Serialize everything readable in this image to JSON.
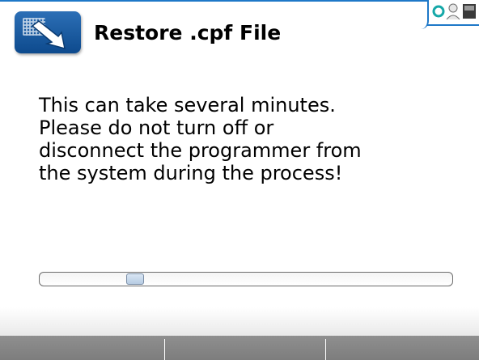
{
  "header": {
    "title": "Restore .cpf File",
    "icon": "restore-arrow-icon",
    "accent_color": "#1e78c8"
  },
  "status_icons": [
    "connection-icon",
    "user-icon",
    "battery-icon"
  ],
  "message": {
    "lines": [
      "This can take several minutes.",
      "Please do not turn off or",
      "disconnect the programmer from",
      "the system during the process!"
    ]
  },
  "progress": {
    "value": 0.22
  },
  "softkeys": [
    {
      "label": ""
    },
    {
      "label": ""
    },
    {
      "label": ""
    }
  ]
}
